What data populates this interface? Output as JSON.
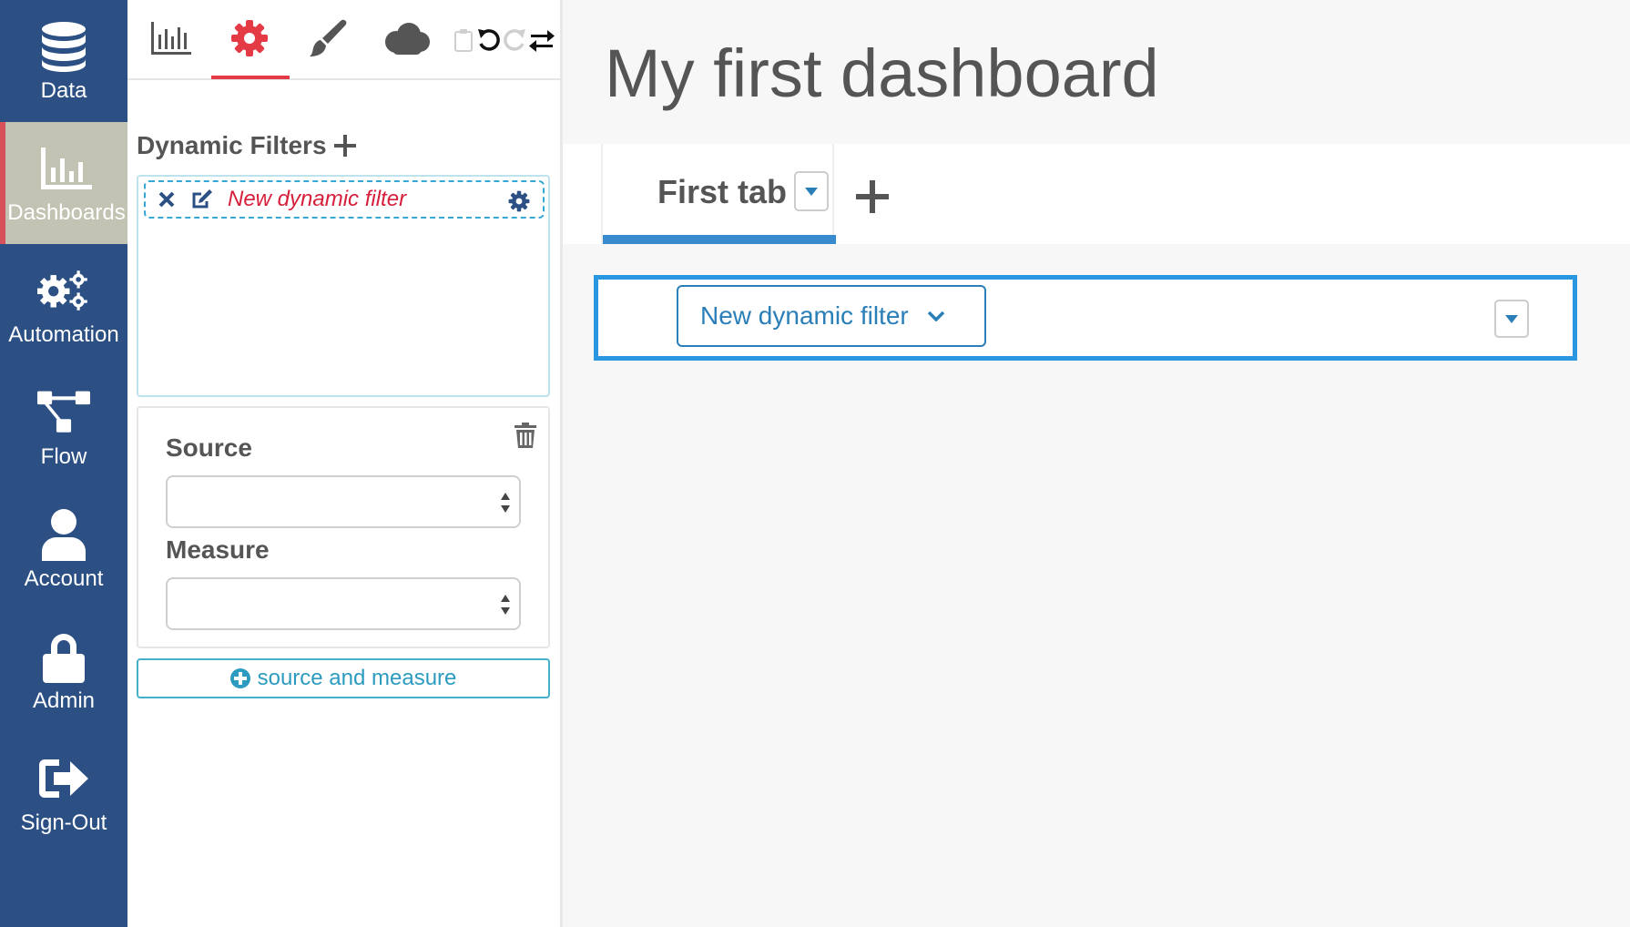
{
  "nav": {
    "items": [
      {
        "label": "Data",
        "icon": "database-icon"
      },
      {
        "label": "Dashboards",
        "icon": "bar-chart-icon"
      },
      {
        "label": "Automation",
        "icon": "gears-icon"
      },
      {
        "label": "Flow",
        "icon": "sitemap-icon"
      },
      {
        "label": "Account",
        "icon": "user-icon"
      },
      {
        "label": "Admin",
        "icon": "lock-icon"
      },
      {
        "label": "Sign-Out",
        "icon": "sign-out-icon"
      }
    ],
    "active": "Dashboards"
  },
  "toolbar": {
    "tabs": [
      "bar-chart-icon",
      "gear-icon",
      "paintbrush-icon",
      "cloud-icon"
    ],
    "active_tab": "gear-icon",
    "actions": [
      "clipboard-icon",
      "undo-icon",
      "redo-icon",
      "swap-icon"
    ]
  },
  "editor": {
    "dynamic_filters_title": "Dynamic Filters",
    "filter_item_label": "New dynamic filter",
    "source_label": "Source",
    "measure_label": "Measure",
    "source_value": "",
    "measure_value": "",
    "add_source_measure_label": "source and measure"
  },
  "main": {
    "title": "My first dashboard",
    "tab_label": "First tab",
    "dynamic_filter_button": "New dynamic filter"
  },
  "colors": {
    "nav_bg": "#2d5084",
    "nav_active_bg": "#c3c3b4",
    "accent_red": "#e43a46",
    "accent_blue": "#2a97e2",
    "tab_underline": "#3a8ad0"
  }
}
